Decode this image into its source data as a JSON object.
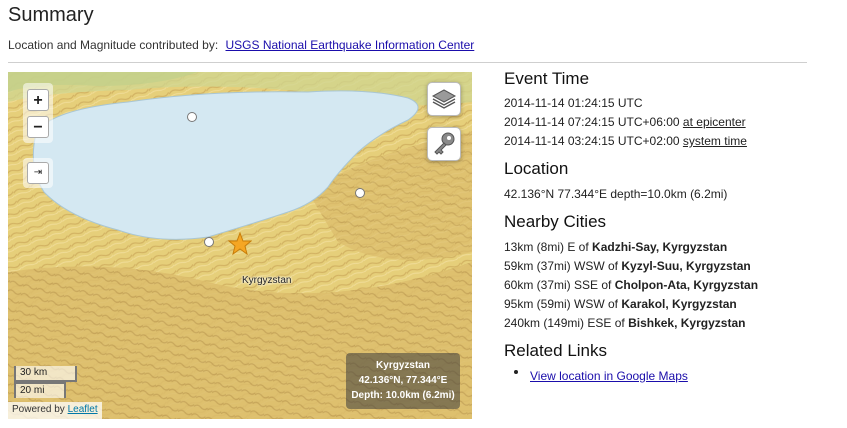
{
  "page_title": "Summary",
  "contrib": {
    "prefix": "Location and Magnitude contributed by:",
    "link": "USGS National Earthquake Information Center"
  },
  "map": {
    "zoom_in_label": "+",
    "zoom_out_label": "−",
    "fullscreen_icon": "⇥",
    "layers_icon": "layers-icon",
    "key_icon": "key-icon",
    "region_label": "Kyrgyzstan",
    "scale_km": "30 km",
    "scale_mi": "20 mi",
    "attribution_prefix": "Powered by",
    "attribution_link": "Leaflet",
    "info": {
      "line1": "Kyrgyzstan",
      "line2": "42.136°N, 77.344°E",
      "line3": "Depth: 10.0km (6.2mi)"
    },
    "colors": {
      "lake": "#d4e8f2",
      "land": "#e8d27a",
      "highland": "#d9b868",
      "epicenter": "#f5a623"
    }
  },
  "event_time": {
    "heading": "Event Time",
    "utc": "2014-11-14 01:24:15 UTC",
    "epicenter_time": "2014-11-14 07:24:15 UTC+06:00",
    "epicenter_link": "at epicenter",
    "system_time": "2014-11-14 03:24:15 UTC+02:00",
    "system_link": "system time"
  },
  "location": {
    "heading": "Location",
    "text": "42.136°N 77.344°E depth=10.0km (6.2mi)"
  },
  "nearby": {
    "heading": "Nearby Cities",
    "cities": [
      {
        "dist": "13km (8mi) E of",
        "name": "Kadzhi-Say, Kyrgyzstan"
      },
      {
        "dist": "59km (37mi) WSW of",
        "name": "Kyzyl-Suu, Kyrgyzstan"
      },
      {
        "dist": "60km (37mi) SSE of",
        "name": "Cholpon-Ata, Kyrgyzstan"
      },
      {
        "dist": "95km (59mi) WSW of",
        "name": "Karakol, Kyrgyzstan"
      },
      {
        "dist": "240km (149mi) ESE of",
        "name": "Bishkek, Kyrgyzstan"
      }
    ]
  },
  "related": {
    "heading": "Related Links",
    "link": "View location in Google Maps"
  }
}
